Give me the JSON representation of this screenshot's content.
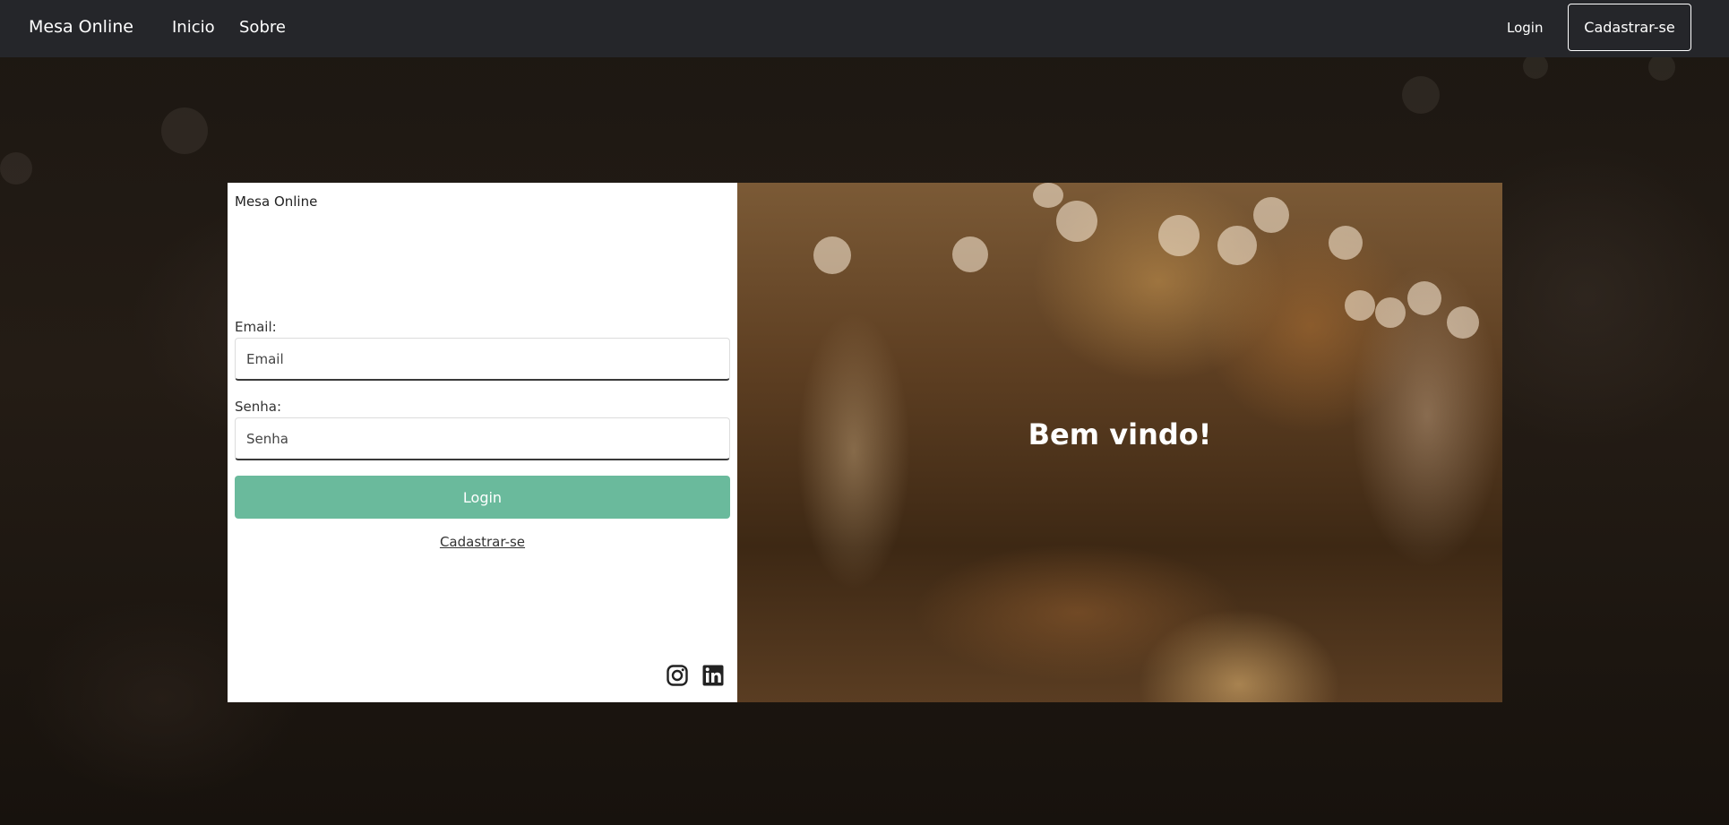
{
  "navbar": {
    "brand": "Mesa Online",
    "links": [
      {
        "label": "Inicio"
      },
      {
        "label": "Sobre"
      }
    ],
    "login_label": "Login",
    "signup_label": "Cadastrar-se"
  },
  "login_card": {
    "brand": "Mesa Online",
    "email": {
      "label": "Email:",
      "placeholder": "Email",
      "value": ""
    },
    "password": {
      "label": "Senha:",
      "placeholder": "Senha",
      "value": ""
    },
    "submit_label": "Login",
    "signup_link": "Cadastrar-se",
    "social_icons": [
      "instagram-icon",
      "linkedin-icon"
    ],
    "accent_color": "#6aba9c"
  },
  "welcome_panel": {
    "heading": "Bem vindo!"
  }
}
